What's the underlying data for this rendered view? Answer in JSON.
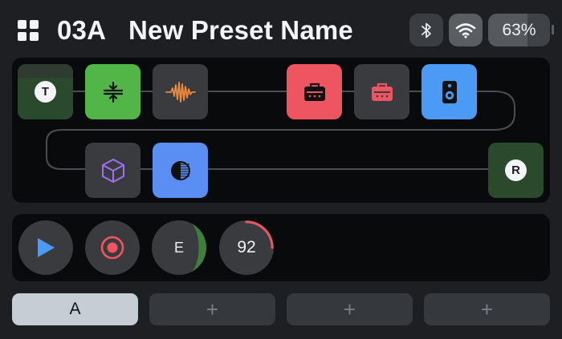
{
  "header": {
    "preset_number": "03A",
    "preset_name": "New Preset Name",
    "battery_percent": 63,
    "battery_label": "63%",
    "icons": [
      "grid-icon",
      "bluetooth-icon",
      "wifi-icon"
    ]
  },
  "chain": {
    "input_label": "T",
    "output_label": "R",
    "blocks": [
      {
        "name": "input",
        "icon": "input-icon"
      },
      {
        "name": "compressor",
        "icon": "compressor-icon",
        "color": "#52b548"
      },
      {
        "name": "gate",
        "icon": "waveform-icon",
        "color": "#f08a3c"
      },
      {
        "name": "amp",
        "icon": "amp-icon",
        "color": "#ef5560"
      },
      {
        "name": "amp-bypassed",
        "icon": "amp-icon",
        "color": "#ef5560"
      },
      {
        "name": "cab",
        "icon": "speaker-icon",
        "color": "#4b9af5"
      },
      {
        "name": "fx",
        "icon": "cube-icon",
        "color": "#a070f0"
      },
      {
        "name": "dynamics",
        "icon": "half-circle-icon",
        "color": "#5b8ef2"
      },
      {
        "name": "output",
        "icon": "output-icon"
      }
    ]
  },
  "transport": {
    "tuner_label": "E",
    "tempo_label": "92",
    "accent_colors": {
      "play": "#4b9af5",
      "record": "#ef5560",
      "tuner": "#3f7f3c",
      "tempo": "#ef5560"
    }
  },
  "snapshots": [
    {
      "label": "A",
      "active": true
    },
    {
      "label": "+",
      "active": false
    },
    {
      "label": "+",
      "active": false
    },
    {
      "label": "+",
      "active": false
    }
  ]
}
